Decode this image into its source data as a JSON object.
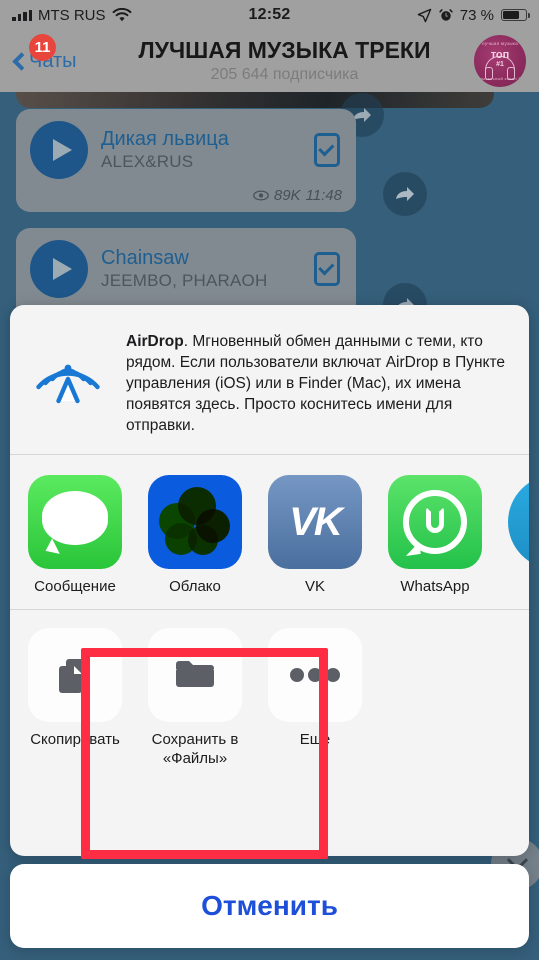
{
  "statusbar": {
    "carrier": "MTS RUS",
    "time": "12:52",
    "battery_percent": "73 %",
    "wifi_icon": "wifi-icon",
    "location_icon": "location-arrow-icon",
    "alarm_icon": "alarm-clock-icon",
    "signal_icon": "cellular-signal-icon",
    "battery_icon": "battery-icon"
  },
  "navbar": {
    "back_label": "Чаты",
    "badge_count": "11",
    "title": "ЛУЧШАЯ МУЗЫКА ТРЕКИ",
    "subtitle": "205 644 подписчика",
    "avatar_top_text": "лучшая музыка",
    "avatar_word": "топ",
    "avatar_hash": "#1",
    "avatar_bottom_text": "музыкальный канал №1"
  },
  "chat": {
    "messages": [
      {
        "title": "Дикая львица",
        "artist": "ALEX&RUS",
        "views": "89K",
        "time": "11:48"
      },
      {
        "title": "Chainsaw",
        "artist": "JEEMBO, PHARAOH",
        "views": "",
        "time": ""
      }
    ]
  },
  "share_sheet": {
    "airdrop": {
      "name": "AirDrop",
      "description": ". Мгновенный обмен данными с теми, кто рядом. Если пользователи включат AirDrop в Пункте управления (iOS) или в Finder (Mac), их имена появятся здесь. Просто коснитесь имени для отправки."
    },
    "apps": [
      {
        "label": "Сообщение",
        "icon": "messages-icon"
      },
      {
        "label": "Облако",
        "icon": "mailru-cloud-icon"
      },
      {
        "label": "VK",
        "icon": "vk-icon",
        "glyph": "VK"
      },
      {
        "label": "WhatsApp",
        "icon": "whatsapp-icon"
      }
    ],
    "actions": [
      {
        "label": "Скопировать",
        "icon": "copy-icon"
      },
      {
        "label": "Сохранить в «Файлы»",
        "icon": "folder-icon"
      },
      {
        "label": "Еще",
        "icon": "more-dots-icon"
      }
    ],
    "cancel_label": "Отменить"
  },
  "colors": {
    "accent_blue": "#1d4fd8",
    "annotation_red": "#ff2d43",
    "badge_red": "#e8453c",
    "telegram_blue": "#1a6aa8",
    "chat_background": "#3c6b88"
  }
}
